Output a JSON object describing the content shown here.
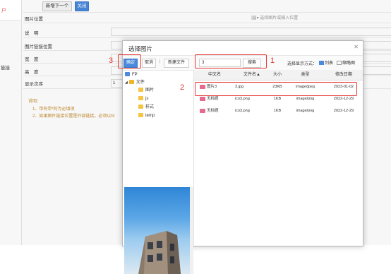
{
  "toolbar": {
    "next_label": "新增下一个",
    "close_label": "关闭"
  },
  "left": {
    "top_char": "户",
    "link_text": "链接"
  },
  "form": {
    "labels": [
      "图片位置",
      "说　明",
      "图片链接位置",
      "宽　度",
      "高　度",
      "显示次序"
    ],
    "order_value": "1",
    "upload_hint": "选择图片或输入位置",
    "notes_title": "说明：",
    "notes": [
      "1．带有带*的为必填项",
      "2．如果图片链接位置是外部链接，必须以ht"
    ]
  },
  "dialog": {
    "title": "选择图片",
    "confirm_label": "确定",
    "cancel_label": "取消",
    "new_folder_label": "新建文件",
    "search_value": "3",
    "search_button": "搜索",
    "display_mode_label": "选择显示方式：",
    "list_view_label": "列表",
    "thumb_view_label": "缩略图",
    "tree": {
      "root": "FP",
      "folder": "文件",
      "children": [
        "图片",
        "js",
        "样式",
        "temp"
      ]
    },
    "table": {
      "headers": [
        "中文名",
        "文件名▲",
        "大小",
        "类型",
        "修改日期"
      ],
      "rows": [
        [
          "图片3",
          "3.jpg",
          "23KB",
          "image/jpeg",
          "2023-01-02"
        ],
        [
          "无标题",
          "ico3.png",
          "1KB",
          "image/png",
          "2022-12-29"
        ],
        [
          "无标题",
          "ico3.png",
          "1KB",
          "image/png",
          "2022-12-29"
        ]
      ]
    }
  },
  "annotations": {
    "one": "1",
    "two": "2",
    "three": "3"
  },
  "colors": {
    "accent": "#4a89dc",
    "annotation": "#e53935"
  }
}
